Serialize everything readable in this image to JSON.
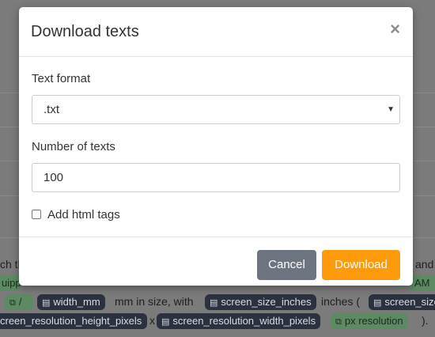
{
  "modal": {
    "title": "Download texts",
    "close_symbol": "×",
    "format_label": "Text format",
    "format_selected": ".txt",
    "count_label": "Number of texts",
    "count_value": "100",
    "html_tags_label": "Add html tags",
    "html_tags_checked": false,
    "cancel_label": "Cancel",
    "download_label": "Download"
  },
  "background": {
    "text_left": "ch th",
    "text_right": "and",
    "equip_fragment": "uipp",
    "am_fragment": "AM",
    "slash": "/",
    "pill_width": "width_mm",
    "text_mm": "mm in size, with",
    "pill_screen_inches": "screen_size_inches",
    "text_inches": "inches (",
    "pill_screen_size": "screen_size",
    "pill_res_height": "creen_resolution_height_pixels",
    "text_x": "x",
    "pill_res_width": "screen_resolution_width_pixels",
    "pill_px_res": "px resolution",
    "text_end": ")."
  },
  "colors": {
    "accent": "#ff9b0a",
    "cancel": "#6c7580",
    "overlay": "#7b7b7b"
  }
}
